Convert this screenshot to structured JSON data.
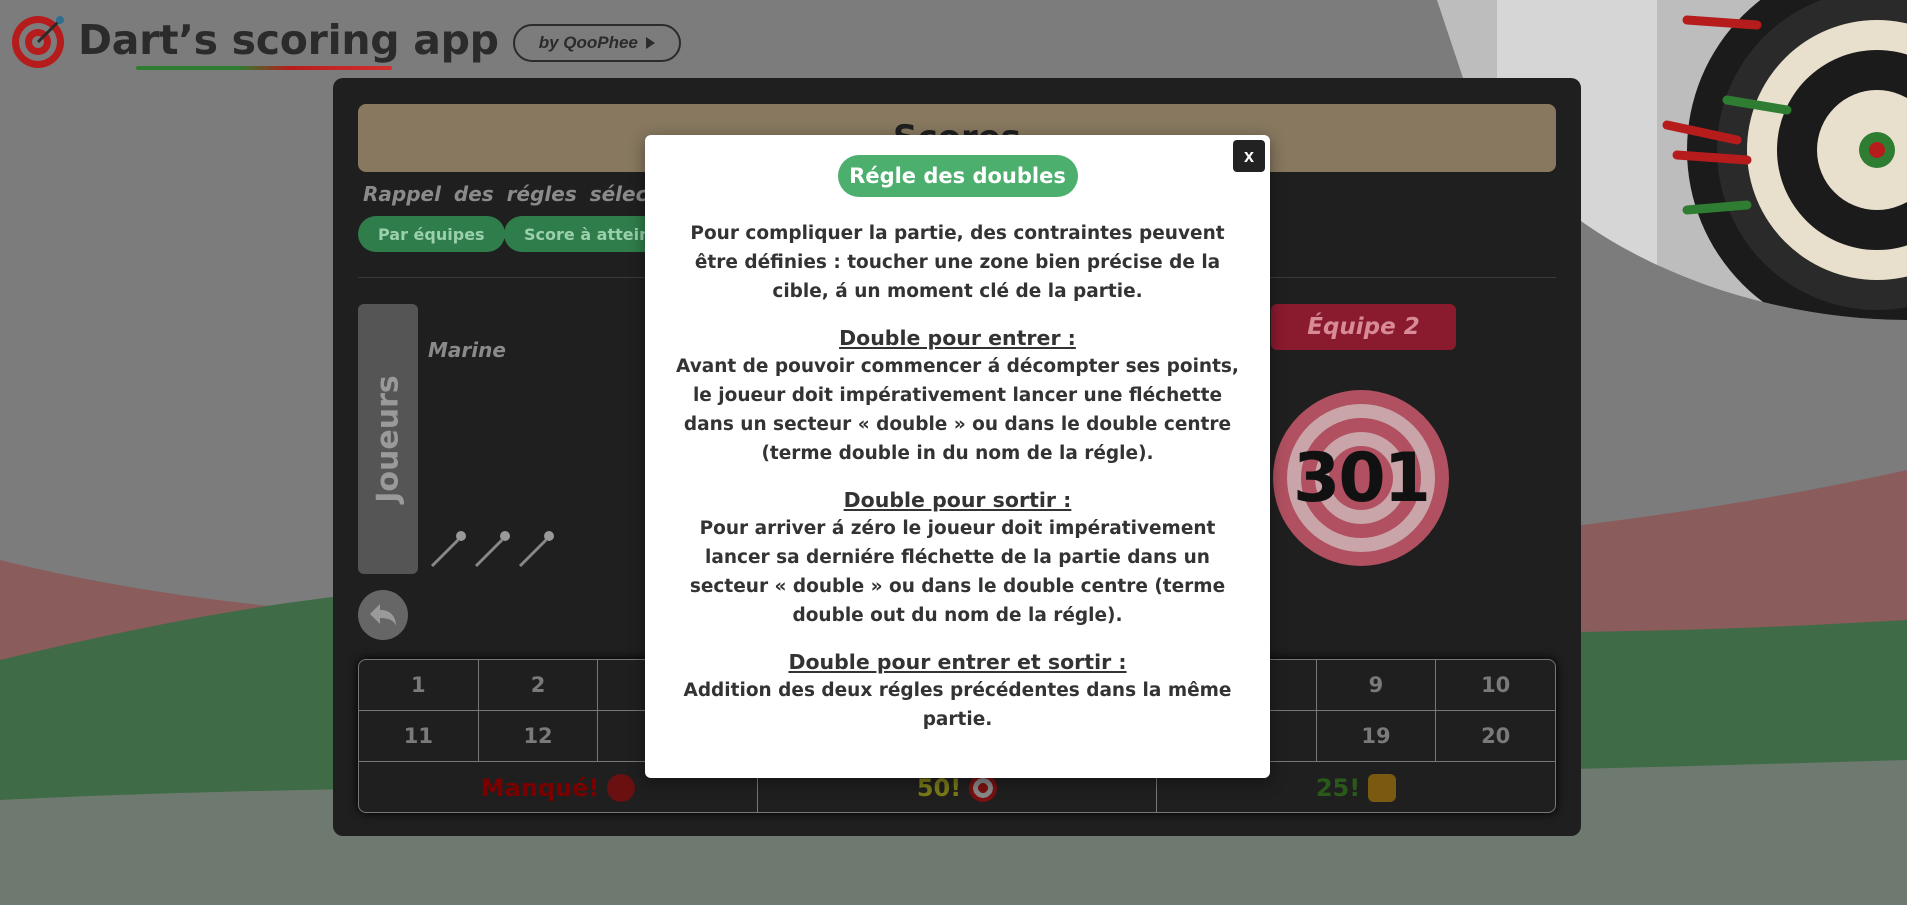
{
  "header": {
    "title": "Dart’s scoring app",
    "by_label": "by QooPhee"
  },
  "panel": {
    "scores_title": "Scores",
    "rules_label": "Rappel des régles sélection",
    "pills": [
      "Par équipes",
      "Score à atteind"
    ],
    "players_tab": "Joueurs",
    "player_name": "Marine",
    "team_label": "Équipe 2",
    "team_score": "301"
  },
  "grid": {
    "row1": [
      "1",
      "2",
      "",
      "",
      "",
      "",
      "",
      "",
      "9",
      "10"
    ],
    "row2": [
      "11",
      "12",
      "",
      "",
      "",
      "",
      "",
      "",
      "19",
      "20"
    ],
    "missed": "Manqué!",
    "bull50": "50!",
    "bull25": "25!"
  },
  "modal": {
    "title": "Régle des doubles",
    "close": "x",
    "intro": "Pour compliquer la partie, des contraintes peuvent être définies : toucher une zone bien précise de la cible, á un moment clé de la partie.",
    "sections": [
      {
        "title": "Double pour entrer :",
        "text": "Avant de pouvoir commencer á décompter ses points, le joueur doit impérativement lancer une fléchette dans un secteur « double » ou dans le double centre (terme double in du nom de la régle)."
      },
      {
        "title": "Double pour sortir :",
        "text": "Pour arriver á zéro le joueur doit impérativement lancer sa derniére fléchette de la partie dans un secteur « double » ou dans le double centre (terme double out du nom de la régle)."
      },
      {
        "title": "Double pour entrer et sortir :",
        "text": "Addition des deux régles précédentes dans la même partie."
      }
    ]
  },
  "colors": {
    "accent_green": "#4caf6e",
    "team_red": "#8a1a2e",
    "panel_bg": "#1f1f1f"
  }
}
